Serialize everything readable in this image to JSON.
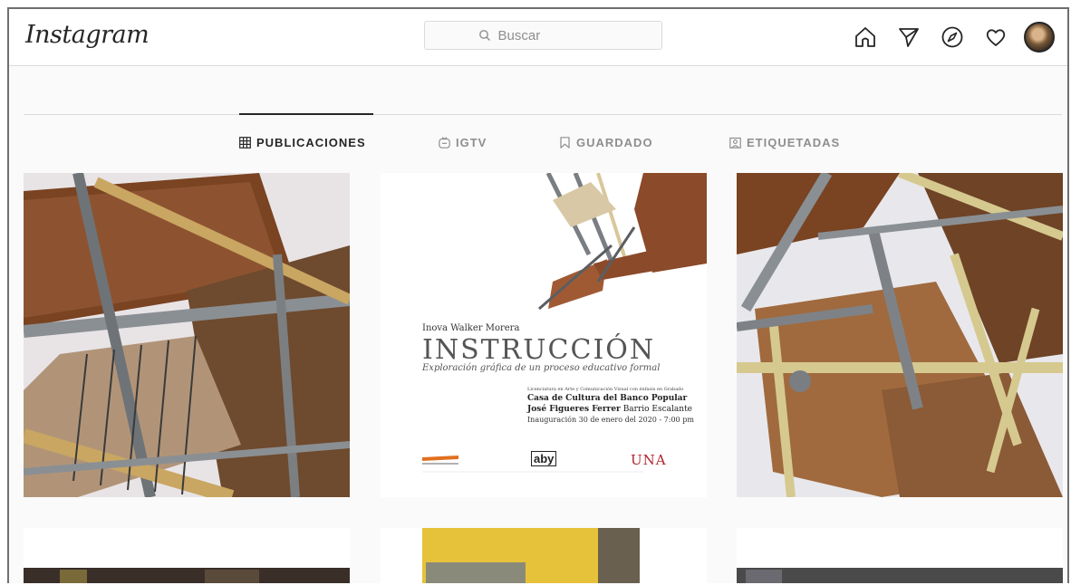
{
  "app": {
    "logo_text": "Instagram"
  },
  "search": {
    "placeholder": "Buscar",
    "icon": "search-icon"
  },
  "nav": {
    "icons": [
      "home-icon",
      "direct-send-icon",
      "explore-compass-icon",
      "activity-heart-icon",
      "profile-avatar"
    ]
  },
  "tabs": [
    {
      "label": "PUBLICACIONES",
      "icon": "grid-icon",
      "active": true
    },
    {
      "label": "IGTV",
      "icon": "igtv-icon",
      "active": false
    },
    {
      "label": "GUARDADO",
      "icon": "bookmark-icon",
      "active": false
    },
    {
      "label": "ETIQUETADAS",
      "icon": "tagged-icon",
      "active": false
    }
  ],
  "poster": {
    "artist": "Inova Walker Morera",
    "title": "INSTRUCCIÓN",
    "subtitle": "Exploración gráfica de un proceso educativo formal",
    "small_line": "Licenciatura en Arte y Comunicación Visual con énfasis en Grabado",
    "venue": "Casa de Cultura del Banco Popular",
    "address_bold": "José Figueres Ferrer",
    "address_rest": "Barrio Escalante",
    "inauguration": "Inauguración 30 de enero del 2020 - 7:00 pm",
    "logo_right": "UNA",
    "logo_center": "aby"
  },
  "colors": {
    "background": "#fafafa",
    "border": "#dbdbdb",
    "text": "#262626",
    "muted": "#8e8e8e"
  }
}
